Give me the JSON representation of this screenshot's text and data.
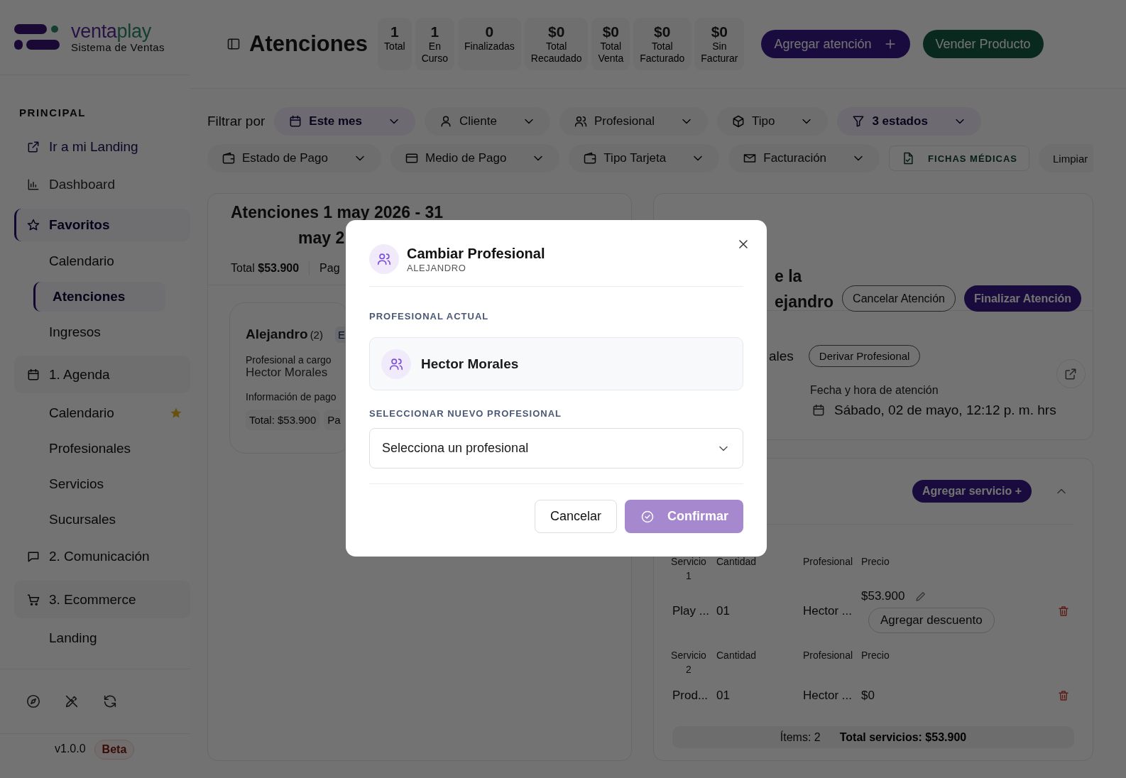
{
  "logo": {
    "name_parts": [
      "venta",
      "play"
    ],
    "tagline": "Sistema de Ventas"
  },
  "header": {
    "title": "Atenciones",
    "stats": [
      {
        "value": "1",
        "label": "Total"
      },
      {
        "value": "1",
        "label": "En Curso"
      },
      {
        "value": "0",
        "label": "Finalizadas"
      },
      {
        "value": "$0",
        "label": "Total Recaudado"
      },
      {
        "value": "$0",
        "label": "Total Venta"
      },
      {
        "value": "$0",
        "label": "Total Facturado"
      },
      {
        "value": "$0",
        "label": "Sin Facturar"
      }
    ],
    "buttons": [
      {
        "label": "Agregar atención",
        "kind": "primary"
      },
      {
        "label": "Vender Producto",
        "kind": "sale"
      }
    ]
  },
  "sidebar": {
    "section_label": "PRINCIPAL",
    "items": [
      {
        "label": "Ir a mi Landing",
        "kind": "link",
        "selected": false
      },
      {
        "label": "Dashboard",
        "kind": "page",
        "selected": false
      },
      {
        "label": "Favoritos",
        "kind": "page",
        "selected": true,
        "children": [
          {
            "label": "Calendario",
            "selected": false,
            "starred": false
          },
          {
            "label": "Atenciones",
            "selected": true,
            "starred": false
          },
          {
            "label": "Ingresos",
            "selected": false,
            "starred": false
          }
        ]
      },
      {
        "label": "1. Agenda",
        "kind": "group",
        "selected": false,
        "children": [
          {
            "label": "Calendario",
            "selected": false,
            "starred": true
          },
          {
            "label": "Profesionales",
            "selected": false,
            "starred": false
          },
          {
            "label": "Servicios",
            "selected": false,
            "starred": false
          },
          {
            "label": "Sucursales",
            "selected": false,
            "starred": false
          }
        ]
      },
      {
        "label": "2. Comunicación",
        "kind": "group",
        "selected": false
      },
      {
        "label": "3. Ecommerce",
        "kind": "group",
        "selected": false,
        "children": [
          {
            "label": "Landing",
            "selected": false,
            "starred": false
          }
        ]
      }
    ],
    "footer": {
      "version": "v1.0.0",
      "badge": "Beta"
    }
  },
  "filters": {
    "label": "Filtrar por",
    "rows": [
      {
        "items": [
          {
            "label": "Este mes",
            "kind": "dropdown",
            "active": true
          },
          {
            "label": "Cliente",
            "kind": "dropdown",
            "active": false
          },
          {
            "label": "Profesional",
            "kind": "dropdown",
            "active": false
          },
          {
            "label": "Tipo",
            "kind": "dropdown",
            "active": false
          },
          {
            "label": "3 estados",
            "kind": "dropdown",
            "active": true
          }
        ]
      },
      {
        "items": [
          {
            "label": "Estado de Pago",
            "kind": "dropdown",
            "active": false
          },
          {
            "label": "Medio de Pago",
            "kind": "dropdown",
            "active": false
          },
          {
            "label": "Tipo Tarjeta",
            "kind": "dropdown",
            "active": false
          },
          {
            "label": "Facturación",
            "kind": "dropdown",
            "active": false
          },
          {
            "label": "FICHAS MÉDICAS",
            "kind": "action",
            "active": false
          },
          {
            "label": "Limpiar",
            "kind": "plain",
            "active": false
          }
        ]
      }
    ]
  },
  "list_panel": {
    "title_lines": [
      "Atenciones 1 may 2026 - 31",
      "may 2"
    ],
    "total_label": "Total",
    "total_value": "$53.900",
    "paid_label": "Pag",
    "card": {
      "name": "Alejandro",
      "count": "(2)",
      "badge": "E",
      "professional_label": "Profesional a cargo",
      "professional": "Hector Morales",
      "payment_label": "Información de pago",
      "chips": [
        "Total: $53.900",
        "Pa"
      ]
    }
  },
  "detail_panel": {
    "title_lines": [
      "e la",
      "ejandro"
    ],
    "buttons": [
      {
        "label": "Cancelar Atención",
        "kind": "outline"
      },
      {
        "label": "Finalizar Atención",
        "kind": "primary"
      }
    ],
    "professional_fragment": "ales",
    "derive_button": "Derivar Profesional",
    "date_label": "Fecha y hora de atención",
    "date": "Sábado, 02 de mayo, 12:12 p. m. hrs",
    "services": {
      "add_button": "Agregar servicio +",
      "expanded": true,
      "rows": [
        {
          "headers": [
            "Servicio",
            "1",
            "Cantidad",
            "Profesional",
            "Precio"
          ],
          "service": "Play ...",
          "quantity": "01",
          "professional": "Hector ...",
          "price": "$53.900",
          "editable": true,
          "discount_button": "Agregar descuento"
        },
        {
          "headers": [
            "Servicio",
            "2",
            "Cantidad",
            "Profesional",
            "Precio"
          ],
          "service": "Prod...",
          "quantity": "01",
          "professional": "Hector ...",
          "price": "$0",
          "editable": false
        }
      ],
      "items_count": "Ítems: 2",
      "total": "Total servicios: $53.900"
    }
  },
  "modal": {
    "title": "Cambiar Profesional",
    "subtitle": "ALEJANDRO",
    "current_label": "PROFESIONAL ACTUAL",
    "current": "Hector Morales",
    "select_label": "SELECCIONAR NUEVO PROFESIONAL",
    "select": {
      "placeholder": "Selecciona un profesional"
    },
    "buttons": [
      {
        "label": "Cancelar",
        "kind": "secondary",
        "disabled": false
      },
      {
        "label": "Confirmar",
        "kind": "confirm",
        "disabled": true
      }
    ]
  }
}
